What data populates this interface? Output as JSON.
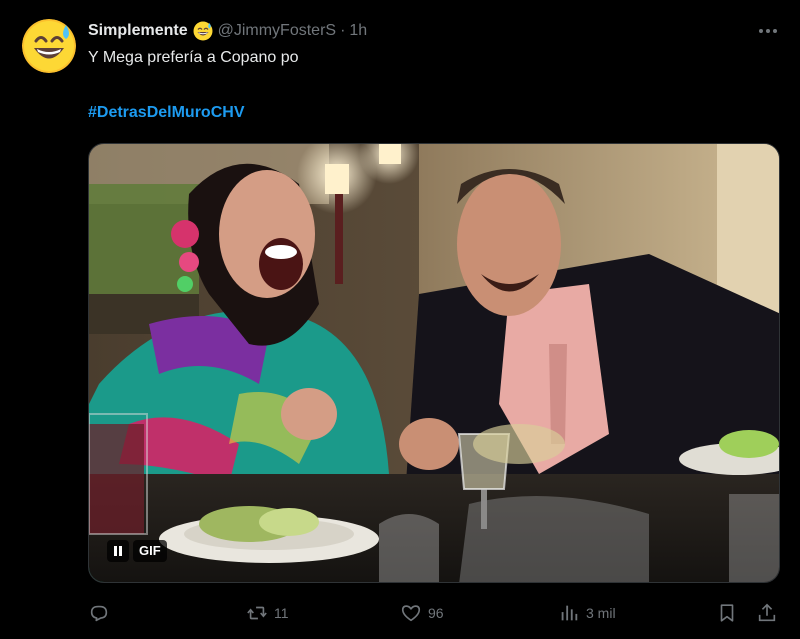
{
  "tweet": {
    "display_name": "Simplemente",
    "name_emoji": "grinning-sweat-emoji",
    "handle": "@JimmyFosterS",
    "separator": "·",
    "time": "1h",
    "text": "Y Mega prefería a Copano po",
    "hashtag": "#DetrasDelMuroCHV",
    "more_icon": "more-dots-icon"
  },
  "media": {
    "type": "gif",
    "badge": "GIF",
    "pause_icon": "pause-icon"
  },
  "actions": {
    "reply": {
      "icon": "reply-icon",
      "count": ""
    },
    "retweet": {
      "icon": "retweet-icon",
      "count": "11"
    },
    "like": {
      "icon": "heart-icon",
      "count": "96"
    },
    "views": {
      "icon": "views-icon",
      "count": "3 mil"
    },
    "bookmark": {
      "icon": "bookmark-icon"
    },
    "share": {
      "icon": "share-icon"
    }
  },
  "colors": {
    "background": "#000000",
    "text": "#e7e9ea",
    "muted": "#71767b",
    "link": "#1d9bf0",
    "border": "#2f3336"
  }
}
